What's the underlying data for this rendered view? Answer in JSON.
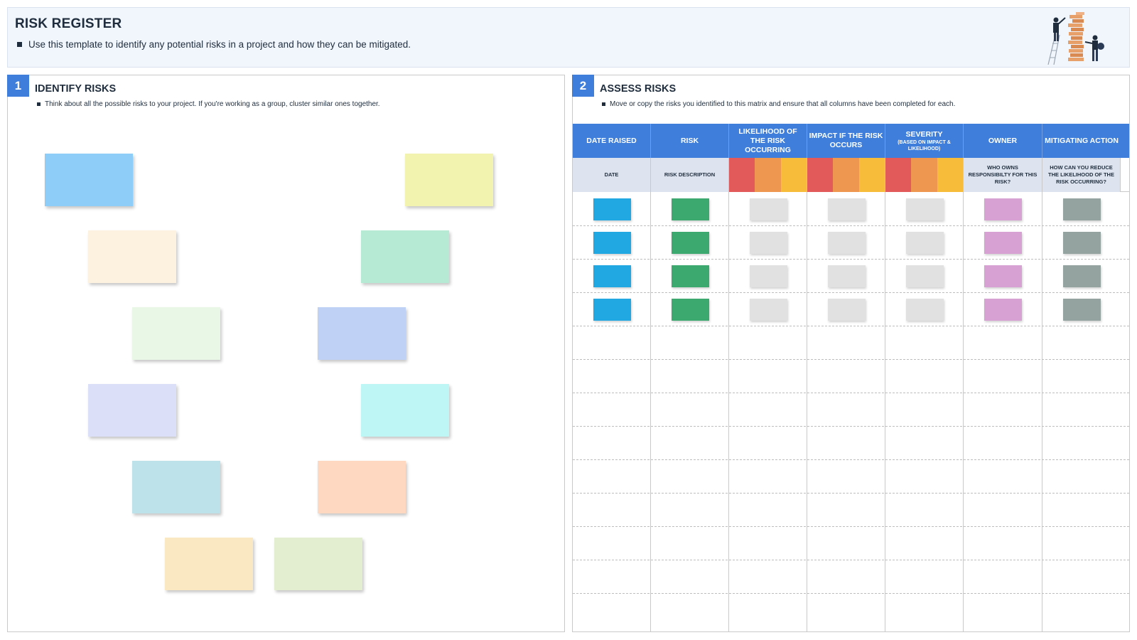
{
  "header": {
    "title": "RISK REGISTER",
    "subtitle": "Use this template to identify any potential risks in a project and how they can be mitigated."
  },
  "identify": {
    "number": "1",
    "title": "IDENTIFY RISKS",
    "description": "Think about all the possible risks to your project. If you're working as a group, cluster similar ones together.",
    "sticky_colors": [
      "#8ecdf8",
      "#f3f3b0",
      "#fdf1e0",
      "#b6ead5",
      "#e9f7e7",
      "#bfd1f5",
      "#dcdff8",
      "#bdf6f5",
      "#bee2e9",
      "#fed8c1",
      "#f9e8c1",
      "#e3eed0"
    ]
  },
  "assess": {
    "number": "2",
    "title": "ASSESS RISKS",
    "description": "Move or copy the risks you identified to this matrix and ensure that all columns have been completed for each.",
    "columns": [
      {
        "label": "DATE RAISED",
        "sub": "DATE"
      },
      {
        "label": "RISK",
        "sub": "RISK DESCRIPTION"
      },
      {
        "label": "LIKELIHOOD OF THE RISK OCCURRING",
        "sub": ""
      },
      {
        "label": "IMPACT IF THE RISK OCCURS",
        "sub": ""
      },
      {
        "label": "SEVERITY",
        "label_small": "(BASED ON IMPACT & LIKELIHOOD)",
        "sub": ""
      },
      {
        "label": "OWNER",
        "sub": "WHO OWNS RESPONSIBILTY FOR THIS RISK?"
      },
      {
        "label": "MITIGATING ACTION",
        "sub": "HOW CAN YOU REDUCE THE LIKELIHOOD OF THE RISK OCCURRING?"
      }
    ],
    "rating_colors": [
      "#e35a5a",
      "#ee9750",
      "#f7bd3a"
    ],
    "block_colors": [
      "#21a8e3",
      "#3caa6f",
      "#e1e1e1",
      "#e1e1e1",
      "#e1e1e1",
      "#d7a1d4",
      "#94a39f"
    ],
    "filled_rows": 4,
    "total_rows": 13
  }
}
